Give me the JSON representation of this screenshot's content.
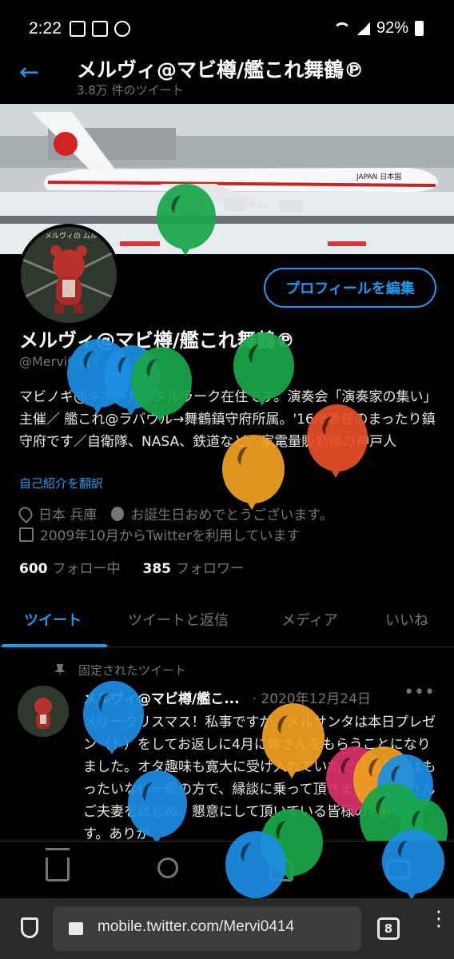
{
  "status_bar": {
    "time": "2:22",
    "battery": "92%"
  },
  "header": {
    "title": "メルヴィ@マビ樽/艦これ舞鶴℗",
    "subtitle": "3.8万 件のツイート"
  },
  "profile": {
    "edit_button": "プロフィールを編集",
    "display_name": "メルヴィ@マビ樽/艦これ舞鶴℗",
    "handle": "@Mervi0414",
    "bio": "マビノギ@キホール→タルラーク在住です。演奏会「演奏家の集い」主催／ 艦これ@ラバウル→舞鶴鎮守府所属。'16/8着任のまったり鎮守府です／自衛隊、NASA、鉄道など／家電量販勤務の神戸人",
    "translate_link": "自己紹介を翻訳",
    "location": "日本 兵庫",
    "birthday": "お誕生日おめでとうございます。",
    "joined": "2009年10月からTwitterを利用しています",
    "following_count": "600",
    "following_label": "フォロー中",
    "followers_count": "385",
    "followers_label": "フォロワー"
  },
  "tabs": [
    {
      "label": "ツイート"
    },
    {
      "label": "ツイートと返信"
    },
    {
      "label": "メディア"
    },
    {
      "label": "いいね"
    }
  ],
  "pinned_tweet": {
    "pinned_label": "固定されたツイート",
    "author": "メルヴィ@マビ樽/艦こ...",
    "date": "· 2020年12月24日",
    "more": "•••",
    "text": "メリークリスマス！私事ですが、メルサンタは本日プレゼン（ト）をしてお返しに4月に嫁さんをもらうことになりました。オタ趣味も寛大に受け入れていただける私にはもったいない一般の方で、縁談に乗って頂きました魅夢さんご夫妻をはじめ、懇意にして頂いている皆様のおかげです。ありが"
  },
  "banner": {
    "plane_text": "JAPAN 日本国"
  },
  "avatar": {
    "label": "メルヴィの ムルト"
  },
  "browser": {
    "url": "mobile.twitter.com/Mervi0414",
    "tab_count": "8"
  },
  "colors": {
    "accent": "#1d9bf0",
    "background": "#000000",
    "muted": "#71767b"
  },
  "icons": {
    "back": "arrow-left-icon",
    "location": "location-pin-icon",
    "birthday": "balloon-icon",
    "calendar": "calendar-icon",
    "pin": "pin-icon",
    "home": "home-icon",
    "search": "search-icon",
    "notifications": "bell-icon",
    "messages": "mail-icon"
  }
}
